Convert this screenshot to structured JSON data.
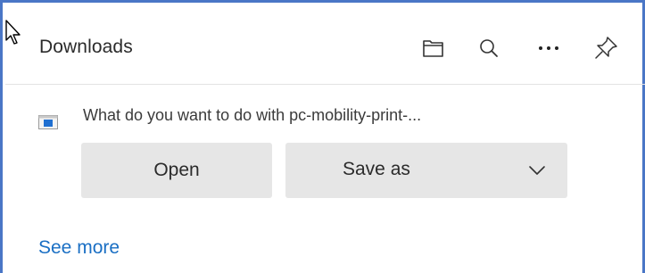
{
  "panel": {
    "title": "Downloads",
    "header_icons": [
      "folder-icon",
      "search-icon",
      "more-icon",
      "pin-icon"
    ]
  },
  "download": {
    "prompt": "What do you want to do with pc-mobility-print-...",
    "file_icon": "installer-file-icon",
    "open_label": "Open",
    "save_as_label": "Save as"
  },
  "footer": {
    "see_more_label": "See more"
  },
  "colors": {
    "frame_border": "#4a76c6",
    "link": "#1a6fc4",
    "button_bg": "#e6e6e6",
    "file_icon_accent": "#1f6fd1"
  }
}
